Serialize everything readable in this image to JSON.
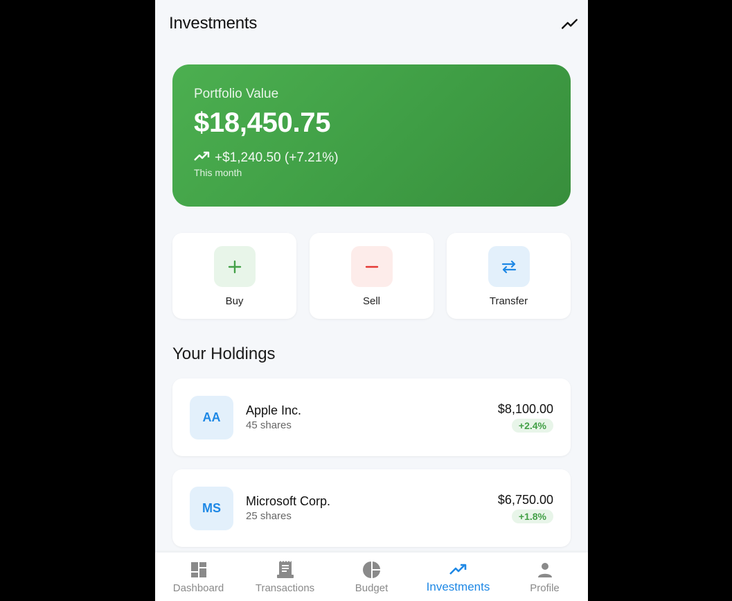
{
  "header": {
    "title": "Investments",
    "action_icon": "trending-up-icon"
  },
  "portfolio": {
    "label": "Portfolio Value",
    "value": "$18,450.75",
    "change": "+$1,240.50 (+7.21%)",
    "period": "This month"
  },
  "actions": [
    {
      "label": "Buy",
      "icon": "plus-icon",
      "color": "#43a047",
      "bg": "#e8f5e9"
    },
    {
      "label": "Sell",
      "icon": "minus-icon",
      "color": "#e53935",
      "bg": "#fdecea"
    },
    {
      "label": "Transfer",
      "icon": "swap-icon",
      "color": "#1e88e5",
      "bg": "#e3f0fb"
    }
  ],
  "holdings_title": "Your Holdings",
  "holdings": [
    {
      "initials": "AA",
      "name": "Apple Inc.",
      "shares": "45 shares",
      "value": "$8,100.00",
      "change": "+2.4%"
    },
    {
      "initials": "MS",
      "name": "Microsoft Corp.",
      "shares": "25 shares",
      "value": "$6,750.00",
      "change": "+1.8%"
    }
  ],
  "nav": {
    "items": [
      {
        "label": "Dashboard",
        "icon": "dashboard-icon"
      },
      {
        "label": "Transactions",
        "icon": "receipt-icon"
      },
      {
        "label": "Budget",
        "icon": "pie-chart-icon"
      },
      {
        "label": "Investments",
        "icon": "trending-up-icon",
        "active": true
      },
      {
        "label": "Profile",
        "icon": "person-icon"
      }
    ]
  },
  "colors": {
    "accent": "#1e88e5",
    "positive": "#43a047",
    "negative": "#e53935",
    "card_green": "#43a047"
  }
}
